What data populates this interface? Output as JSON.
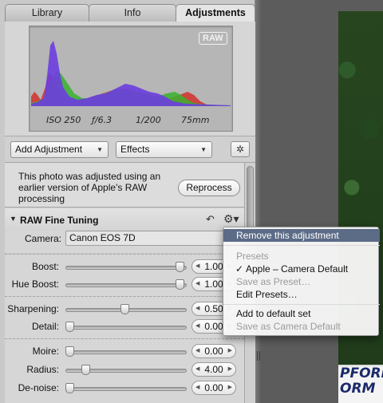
{
  "tabs": [
    {
      "label": "Library"
    },
    {
      "label": "Info"
    },
    {
      "label": "Adjustments"
    }
  ],
  "histogram": {
    "badge": "RAW",
    "iso": "ISO 250",
    "aperture": "ƒ/6.3",
    "shutter": "1/200",
    "focal": "75mm"
  },
  "toolbar": {
    "add_adjustment": "Add Adjustment",
    "effects": "Effects",
    "wand_icon": "magic-wand-icon"
  },
  "notice": {
    "text": "This photo was adjusted using an earlier version of Apple's RAW processing",
    "button": "Reprocess"
  },
  "raw_fine_tuning": {
    "title": "RAW Fine Tuning",
    "camera_label": "Camera:",
    "camera_value": "Canon EOS 7D",
    "boost": {
      "label": "Boost:",
      "value": "1.00",
      "level": 1.0
    },
    "hue_boost": {
      "label": "Hue Boost:",
      "value": "1.00",
      "level": 1.0
    },
    "sharpening": {
      "label": "Sharpening:",
      "value": "0.50",
      "level": 0.5
    },
    "detail": {
      "label": "Detail:",
      "value": "0.00",
      "level": 0.0
    },
    "moire": {
      "label": "Moire:",
      "value": "0.00",
      "level": 0.0
    },
    "radius": {
      "label": "Radius:",
      "value": "4.00",
      "level": 0.16
    },
    "denoise": {
      "label": "De-noise:",
      "value": "0.00",
      "level": 0.0
    }
  },
  "context_menu": {
    "remove": "Remove this adjustment",
    "presets_header": "Presets",
    "preset_check": "✓",
    "preset_apple": "Apple  – Camera Default",
    "save_as_preset": "Save as Preset…",
    "edit_presets": "Edit Presets…",
    "add_default": "Add to default set",
    "save_camera_default": "Save as Camera Default"
  },
  "photo": {
    "sign_line1": "PFORM",
    "sign_line2": "ORM"
  },
  "colors": {
    "menu_highlight": "#5c6b86",
    "histo_red": "#d2302a",
    "histo_green": "#38b32e",
    "histo_blue": "#6b3de0"
  }
}
